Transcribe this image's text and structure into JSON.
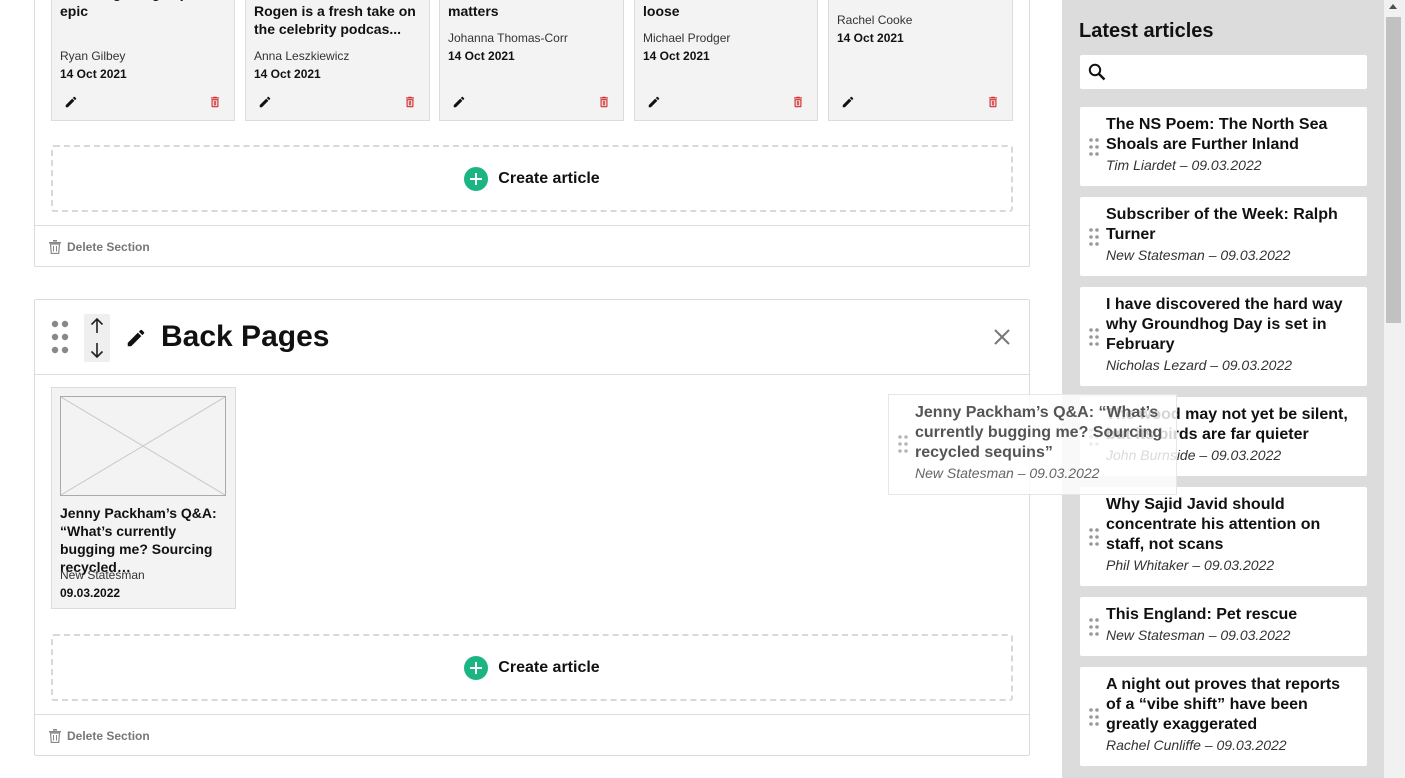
{
  "section1": {
    "cards": [
      {
        "title": "a coming-of-age space epic",
        "author": "Ryan Gilbey",
        "date": "14 Oct 2021"
      },
      {
        "title": "Rogen is a fresh take on the celebrity podcas...",
        "author": "Anna Leszkiewicz",
        "date": "14 Oct 2021"
      },
      {
        "title": "matters",
        "author": "Johanna Thomas-Corr",
        "date": "14 Oct 2021"
      },
      {
        "title": "loose",
        "author": "Michael Prodger",
        "date": "14 Oct 2021"
      },
      {
        "title": "",
        "author": "Rachel Cooke",
        "date": "14 Oct 2021"
      }
    ],
    "create_label": "Create article",
    "delete_label": "Delete Section"
  },
  "section2": {
    "title": "Back Pages",
    "cards": [
      {
        "title": "Jenny Packham’s Q&A: “What’s currently bugging me? Sourcing recycled…",
        "author": "New Statesman",
        "date": "09.03.2022"
      }
    ],
    "create_label": "Create article",
    "delete_label": "Delete Section"
  },
  "drag_ghost": {
    "title": "Jenny Packham’s Q&A: “What’s currently bugging me? Sourcing recycled sequins”",
    "meta": "New Statesman – 09.03.2022"
  },
  "sidebar": {
    "title": "Latest articles",
    "search": {
      "value": "",
      "placeholder": ""
    },
    "items": [
      {
        "title": "The NS Poem: The North Sea Shoals are Further Inland",
        "meta": "Tim Liardet – 09.03.2022"
      },
      {
        "title": "Subscriber of the Week: Ralph Turner",
        "meta": "New Statesman – 09.03.2022"
      },
      {
        "title": "I have discovered the hard way why Groundhog Day is set in February",
        "meta": "Nicholas Lezard – 09.03.2022"
      },
      {
        "title": "The wood may not yet be silent, but its birds are far quieter",
        "meta": "John Burnside – 09.03.2022"
      },
      {
        "title": "Why Sajid Javid should concentrate his attention on staff, not scans",
        "meta": "Phil Whitaker – 09.03.2022"
      },
      {
        "title": "This England: Pet rescue",
        "meta": "New Statesman – 09.03.2022"
      },
      {
        "title": "A night out proves that reports of a “vibe shift” have been greatly exaggerated",
        "meta": "Rachel Cunliffe – 09.03.2022"
      }
    ]
  },
  "icons": {
    "edit": "pencil-icon",
    "delete": "trash-icon",
    "add": "plus-circle-icon",
    "close": "close-icon",
    "drag": "drag-handle-icon",
    "search": "search-icon",
    "up": "arrow-up-icon",
    "down": "arrow-down-icon"
  },
  "colors": {
    "accent": "#1db483",
    "danger": "#d32f2f",
    "sidebar_bg": "#dcdcdc"
  }
}
